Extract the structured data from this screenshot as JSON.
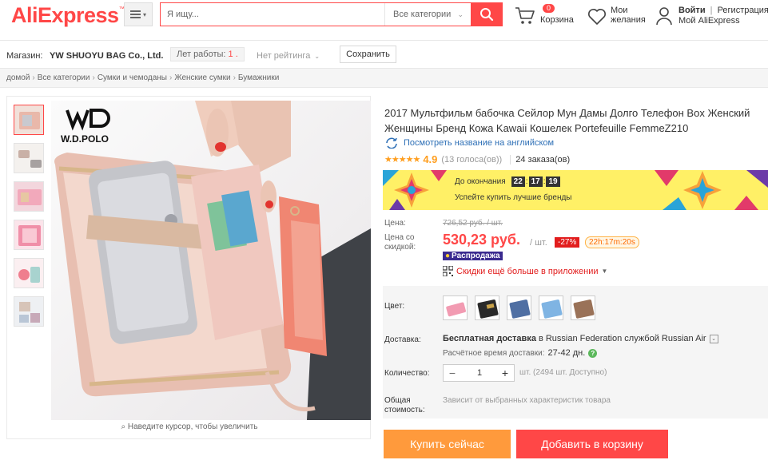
{
  "header": {
    "logo": "AliExpress",
    "logo_mark": "™",
    "search_placeholder": "Я ищу...",
    "search_category": "Все категории",
    "cart_count": "0",
    "cart_label": "Корзина",
    "wishlist_line1": "Мои",
    "wishlist_line2": "желания",
    "login": "Войти",
    "separator": "|",
    "register": "Регистрация",
    "my_account": "Мой AliExpress"
  },
  "store": {
    "label": "Магазин:",
    "name": "YW SHUOYU BAG Co., Ltd.",
    "years_label": "Лет работы:",
    "years_value": "1 .",
    "rating": "Нет рейтинга",
    "save": "Сохранить"
  },
  "breadcrumb": [
    "домой",
    "Все категории",
    "Сумки и чемоданы",
    "Женские сумки",
    "Бумажники"
  ],
  "gallery": {
    "brand": "W.D.POLO",
    "zoom_hint": "Наведите курсор, чтобы увеличить"
  },
  "product": {
    "title": "2017 Мультфильм бабочка Сейлор Мун Дамы Долго Телефон Box Женский Женщины Бренд Кожа Kawaii Кошелек Portefeuille FemmeZ210",
    "translate_link": "Посмотреть название на английском",
    "rating_value": "4.9",
    "votes": "(13 голоса(ов))",
    "orders": "24 заказа(ов)"
  },
  "promo": {
    "ends_label": "До окончания",
    "timer_h": "22",
    "timer_m": "17",
    "timer_s": "19",
    "tagline": "Успейте купить лучшие бренды"
  },
  "price": {
    "price_label": "Цена:",
    "old_price": "726,52 руб. / шт.",
    "discount_label_1": "Цена со",
    "discount_label_2": "скидкой:",
    "new_price": "530,23 руб.",
    "per_unit": "/ шт.",
    "discount": "-27%",
    "countdown": "22h:17m:20s",
    "sale_badge": "Распродажа",
    "app_discount": "Скидки ещё больше в приложении"
  },
  "options": {
    "color_label": "Цвет:",
    "delivery_label": "Доставка:",
    "delivery_free": "Бесплатная доставка",
    "delivery_rest": "в Russian Federation службой Russian Air",
    "delivery_time_label": "Расчётное время доставки:",
    "delivery_time": "27-42 дн.",
    "qty_label": "Количество:",
    "qty_value": "1",
    "qty_minus": "−",
    "qty_plus": "+",
    "availability": "шт. (2494 шт. Доступно)",
    "total_label_1": "Общая",
    "total_label_2": "стоимость:",
    "total_value": "Зависит от выбранных характеристик товара"
  },
  "actions": {
    "buy_now": "Купить сейчас",
    "add_to_cart": "Добавить в корзину"
  },
  "colors": {
    "brand_red": "#ff4747",
    "buy_orange": "#ff9a3c",
    "promo_yellow": "#fff066",
    "link_blue": "#2d6fb6",
    "star_orange": "#ff9e1e"
  },
  "swatches": [
    "pink",
    "black",
    "blue",
    "light-blue",
    "brown"
  ]
}
